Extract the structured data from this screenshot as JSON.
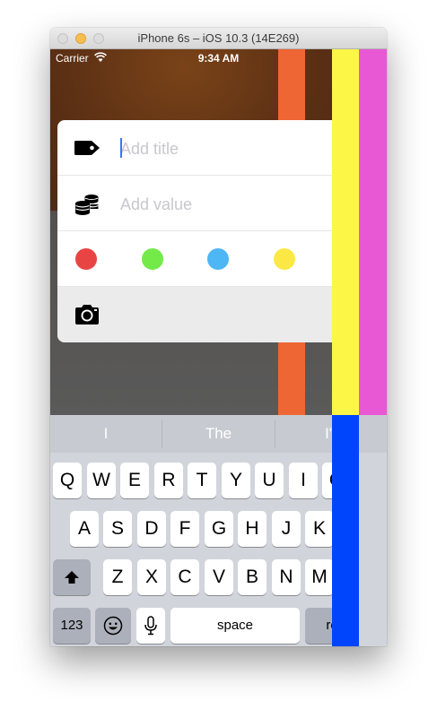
{
  "window": {
    "title": "iPhone 6s – iOS 10.3 (14E269)"
  },
  "status_bar": {
    "carrier": "Carrier",
    "time": "9:34 AM"
  },
  "form": {
    "title_placeholder": "Add title",
    "value_placeholder": "Add value",
    "colors": [
      "#e94444",
      "#74ea49",
      "#4db6f5",
      "#fbe845"
    ]
  },
  "stripes": [
    "#ee6633",
    "#74ea49",
    "#fcf746",
    "#e857d4",
    "#0045fb"
  ],
  "keyboard": {
    "suggestions": [
      "I",
      "The",
      "I'r"
    ],
    "row1": [
      "Q",
      "W",
      "E",
      "R",
      "T",
      "Y",
      "U",
      "I",
      "O"
    ],
    "row2": [
      "A",
      "S",
      "D",
      "F",
      "G",
      "H",
      "J",
      "K"
    ],
    "row3": [
      "Z",
      "X",
      "C",
      "V",
      "B",
      "N",
      "M"
    ],
    "numbers_label": "123",
    "space_label": "space",
    "return_label": "re"
  }
}
